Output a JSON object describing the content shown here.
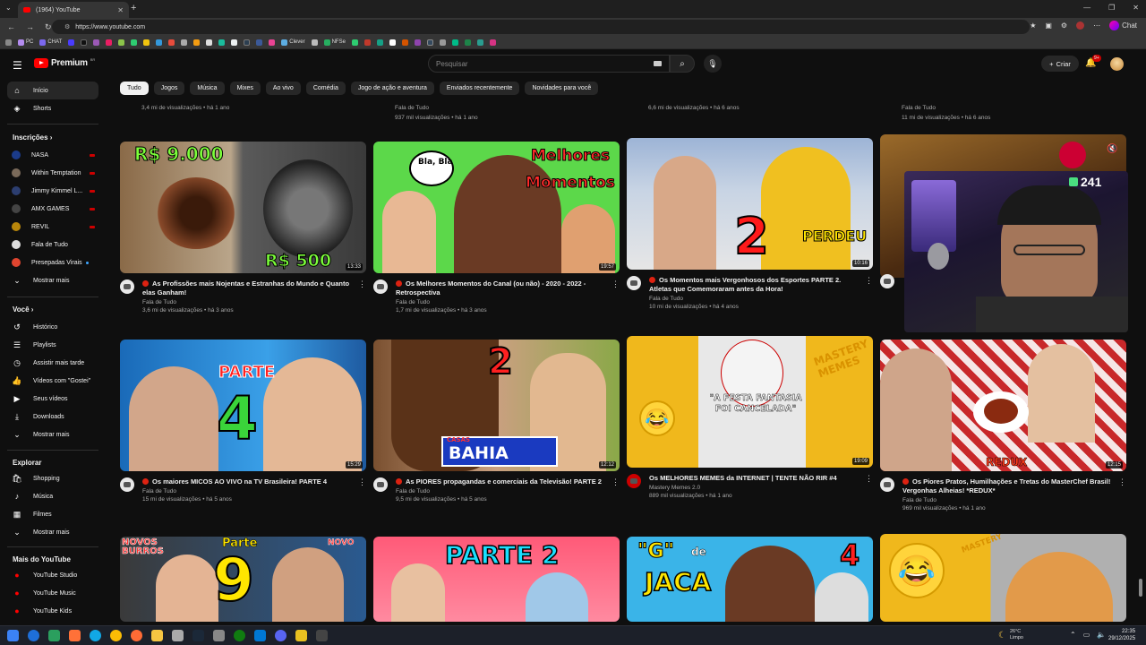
{
  "browser": {
    "tab_title": "(1964) YouTube",
    "url": "https://www.youtube.com",
    "chat_label": "Chat",
    "bookmarks": [
      "PC",
      "CHAT",
      "Clever",
      "NFSe"
    ]
  },
  "header": {
    "logo_text": "Premium",
    "logo_badge": "BR",
    "search_placeholder": "Pesquisar",
    "create_label": "Criar",
    "notifications_badge": "9+"
  },
  "chips": [
    "Tudo",
    "Jogos",
    "Música",
    "Mixes",
    "Ao vivo",
    "Comédia",
    "Jogo de ação e aventura",
    "Enviados recentemente",
    "Novidades para você"
  ],
  "sidebar": {
    "home": "Início",
    "shorts": "Shorts",
    "subscriptions_heading": "Inscrições",
    "subscriptions": [
      "NASA",
      "Within Temptation",
      "Jimmy Kimmel L...",
      "AMX GAMES",
      "REVIL",
      "Fala de Tudo",
      "Presepadas Virais"
    ],
    "show_more": "Mostrar mais",
    "you_heading": "Você",
    "you_items": [
      "Histórico",
      "Playlists",
      "Assistir mais tarde",
      "Vídeos com \"Gostei\"",
      "Seus vídeos",
      "Downloads"
    ],
    "explore_heading": "Explorar",
    "explore_items": [
      "Shopping",
      "Música",
      "Filmes"
    ],
    "more_heading": "Mais do YouTube",
    "more_items": [
      "YouTube Studio",
      "YouTube Music",
      "YouTube Kids"
    ]
  },
  "top_partial": [
    {
      "channel": "",
      "stats": "3,4 mi de visualizações • há 1 ano"
    },
    {
      "channel": "Fala de Tudo",
      "stats": "937 mil visualizações • há 1 ano"
    },
    {
      "channel": "",
      "stats": "6,6 mi de visualizações • há 6 anos"
    },
    {
      "channel": "Fala de Tudo",
      "stats": "11 mi de visualizações • há 6 anos"
    }
  ],
  "videos_row1": [
    {
      "title": "As Profissões mais Nojentas e Estranhas do Mundo e Quanto elas Ganham!",
      "channel": "Fala de Tudo",
      "stats": "3,6 mi de visualizações • há 3 anos",
      "duration": "13:33",
      "thumb_text_1": "R$ 9.000",
      "thumb_text_2": "R$ 500"
    },
    {
      "title": "Os Melhores Momentos do Canal (ou não) - 2020 - 2022 - Retrospectiva",
      "channel": "Fala de Tudo",
      "stats": "1,7 mi de visualizações • há 3 anos",
      "duration": "19:57",
      "thumb_text_1": "Melhores",
      "thumb_text_2": "Momentos",
      "thumb_text_3": "Bla, Bla"
    },
    {
      "title": "Os Momentos mais Vergonhosos dos Esportes PARTE 2. Atletas que Comemoraram antes da Hora!",
      "channel": "Fala de Tudo",
      "stats": "10 mi de visualizações • há 4 anos",
      "duration": "10:16",
      "thumb_text_1": "2",
      "thumb_text_2": "PERDEU"
    }
  ],
  "videos_row2": [
    {
      "title": "Os maiores MICOS AO VIVO na TV Brasileira! PARTE 4",
      "channel": "Fala de Tudo",
      "stats": "15 mi de visualizações • há 5 anos",
      "duration": "15:29",
      "thumb_text_1": "PARTE",
      "thumb_text_2": "4"
    },
    {
      "title": "As PIORES propagandas e comerciais da Televisão! PARTE 2",
      "channel": "Fala de Tudo",
      "stats": "9,5 mi de visualizações • há 5 anos",
      "duration": "12:12",
      "thumb_text_1": "2",
      "thumb_text_2": "CASAS",
      "thumb_text_3": "BAHIA"
    },
    {
      "title": "Os MELHORES MEMES da INTERNET | TENTE NÃO RIR #4",
      "channel": "Mastery Memes 2.0",
      "stats": "889 mil visualizações • há 1 ano",
      "duration": "19:09",
      "thumb_text_1": "\"A FESTA FANTASIA FOI CANCELADA\"",
      "thumb_text_2": "MASTERY MEMES"
    },
    {
      "title": "Os Piores Pratos, Humilhações e Tretas do MasterChef Brasil! Vergonhas Alheias! *REDUX*",
      "channel": "Fala de Tudo",
      "stats": "969 mil visualizações • há 1 ano",
      "duration": "12:15",
      "thumb_text_1": "REDUX"
    }
  ],
  "videos_row3": [
    {
      "thumb_text_1": "NOVOS BURROS",
      "thumb_text_2": "Parte",
      "thumb_text_3": "9",
      "thumb_text_4": "NOVO"
    },
    {
      "thumb_text_1": "PARTE 2"
    },
    {
      "thumb_text_1": "\"G\"",
      "thumb_text_2": "de",
      "thumb_text_3": "JACA",
      "thumb_text_4": "4"
    },
    {
      "thumb_text_1": "MASTERY"
    }
  ],
  "stream_overlay": {
    "viewers": "241"
  },
  "taskbar": {
    "weather_temp": "26°C",
    "weather_desc": "Limpo",
    "time": "22:35",
    "date": "29/12/2025"
  },
  "colors": {
    "accent": "#ff0000",
    "background": "#0f0f0f"
  }
}
